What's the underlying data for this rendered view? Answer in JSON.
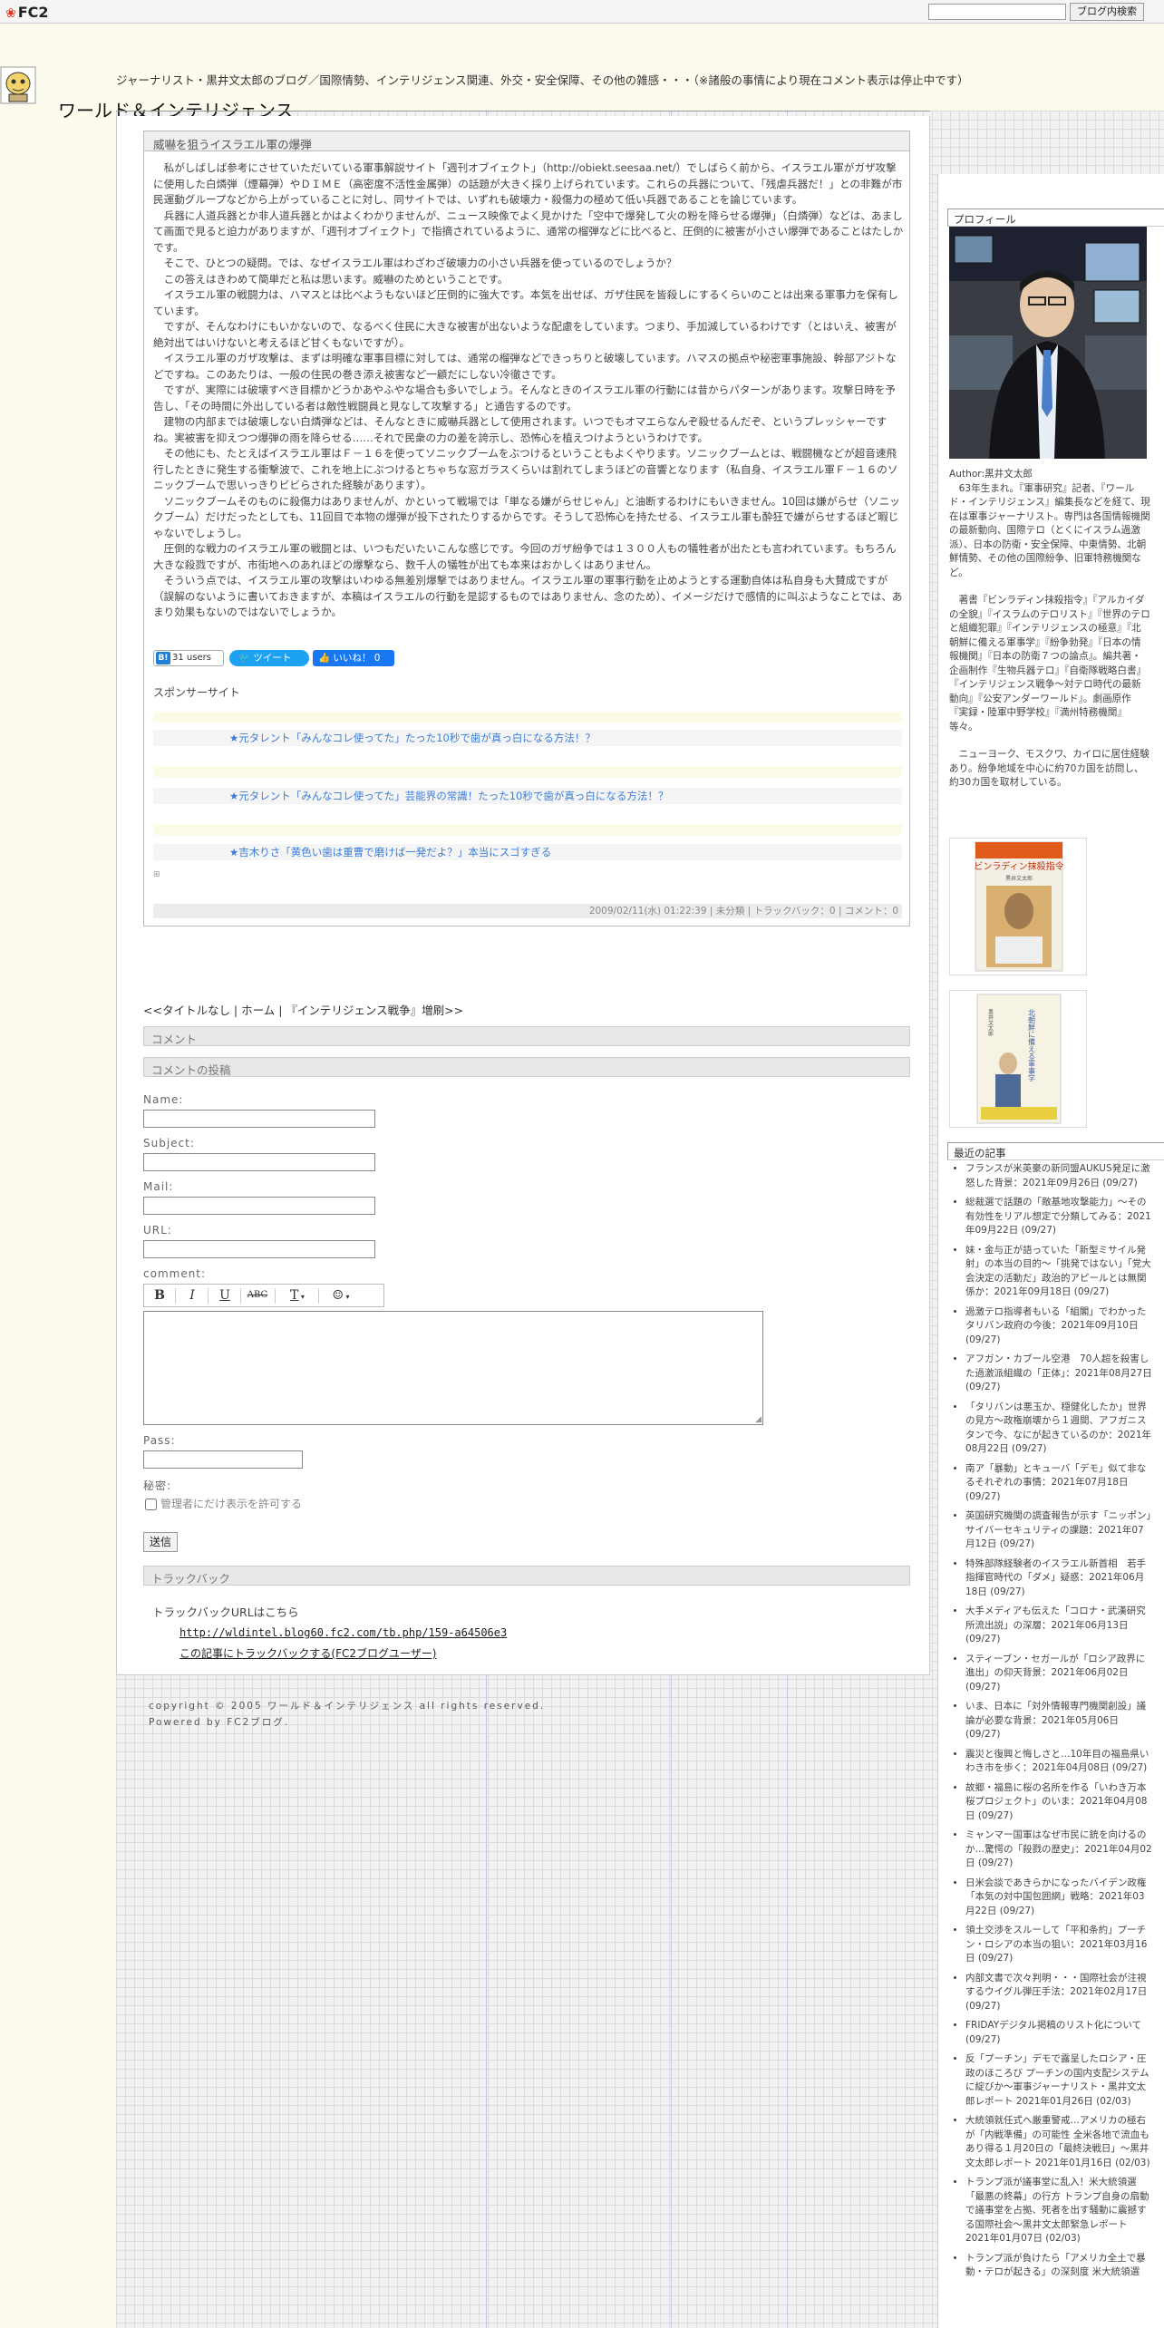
{
  "fc2": {
    "logo": "FC2",
    "search_button": "ブログ内検索"
  },
  "header": {
    "description": "ジャーナリスト・黒井文太郎のブログ／国際情勢、インテリジェンス関連、外交・安全保障、その他の雑感・・・（※諸般の事情により現在コメント表示は停止中です）",
    "title": "ワールド＆インテリジェンス"
  },
  "entry": {
    "title": "威嚇を狙うイスラエル軍の爆弾",
    "paragraphs": [
      "　私がしばしば参考にさせていただいている軍事解説サイト「週刊オブイェクト」（http://obiekt.seesaa.net/）でしばらく前から、イスラエル軍がガザ攻撃に使用した白燐弾（煙幕弾）やＤＩＭＥ（高密度不活性金属弾）の話題が大きく採り上げられています。これらの兵器について、「残虐兵器だ！」との非難が市民運動グループなどから上がっていることに対し、同サイトでは、いずれも破壊力・殺傷力の極めて低い兵器であることを論じています。",
      "　兵器に人道兵器とか非人道兵器とかはよくわかりませんが、ニュース映像でよく見かけた「空中で爆発して火の粉を降らせる爆弾」（白燐弾）などは、あまして画面で見ると迫力がありますが、「週刊オブイェクト」で指摘されているように、通常の榴弾などに比べると、圧倒的に被害が小さい爆弾であることはたしかです。",
      "　そこで、ひとつの疑問。では、なぜイスラエル軍はわざわざ破壊力の小さい兵器を使っているのでしょうか？",
      "　この答えはきわめて簡単だと私は思います。威嚇のためということです。",
      "　イスラエル軍の戦闘力は、ハマスとは比べようもないほど圧倒的に強大です。本気を出せば、ガザ住民を皆殺しにするくらいのことは出来る軍事力を保有しています。",
      "　ですが、そんなわけにもいかないので、なるべく住民に大きな被害が出ないような配慮をしています。つまり、手加減しているわけです（とはいえ、被害が絶対出てはいけないと考えるほど甘くもないですが）。",
      "　イスラエル軍のガザ攻撃は、まずは明確な軍事目標に対しては、通常の榴弾などできっちりと破壊しています。ハマスの拠点や秘密軍事施設、幹部アジトなどですね。このあたりは、一般の住民の巻き添え被害など一顧だにしない冷徹さです。",
      "　ですが、実際には破壊すべき目標かどうかあやふやな場合も多いでしょう。そんなときのイスラエル軍の行動には昔からパターンがあります。攻撃日時を予告し、「その時間に外出している者は敵性戦闘員と見なして攻撃する」と通告するのです。",
      "　建物の内部までは破壊しない白燐弾などは、そんなときに威嚇兵器として使用されます。いつでもオマエらなんぞ殺せるんだぞ、というプレッシャーですね。実被害を抑えつつ爆弾の雨を降らせる……それで民衆の力の差を誇示し、恐怖心を植えつけようというわけです。",
      "　その他にも、たとえばイスラエル軍はＦ－１６を使ってソニックブームをぶつけるということもよくやります。ソニックブームとは、戦闘機などが超音速飛行したときに発生する衝撃波で、これを地上にぶつけるとちゃちな窓ガラスくらいは割れてしまうほどの音響となります（私自身、イスラエル軍Ｆ－１６のソニックブームで思いっきりビビらされた経験があります）。",
      "　ソニックブームそのものに殺傷力はありませんが、かといって戦場では「単なる嫌がらせじゃん」と油断するわけにもいきません。10回は嫌がらせ（ソニックブーム）だけだったとしても、11回目で本物の爆弾が投下されたりするからです。そうして恐怖心を持たせる、イスラエル軍も酔狂で嫌がらせするほど暇じゃないでしょうし。",
      "　圧倒的な戦力のイスラエル軍の戦闘とは、いつもだいたいこんな感じです。今回のガザ紛争では１３００人もの犠牲者が出たとも言われています。もちろん大きな殺戮ですが、市街地へのあれほどの爆撃なら、数千人の犠牲が出ても本来はおかしくはありません。",
      "　そういう点では、イスラエル軍の攻撃はいわゆる無差別爆撃ではありません。イスラエル軍の軍事行動を止めようとする運動自体は私自身も大賛成ですが（誤解のないように書いておきますが、本稿はイスラエルの行動を是認するものではありません、念のため）、イメージだけで感情的に叫ぶようなことでは、あまり効果もないのではないでしょうか。"
    ],
    "share": {
      "hatena_count": "31 users",
      "tweet": "ツイート",
      "like": "いいね！ 0"
    },
    "sponsor_label": "スポンサーサイト",
    "ads": [
      "★元タレント「みんなコレ使ってた」たった10秒で歯が真っ白になる方法！？",
      "★元タレント「みんなコレ使ってた」芸能界の常識！たった10秒で歯が真っ白になる方法！？",
      "★吉木りさ「黄色い歯は重曹で磨けば一発だよ？」本当にスゴすぎる"
    ],
    "footer": "2009/02/11(水) 01:22:39 | 未分類 | トラックバック：0 | コメント：0"
  },
  "nav": {
    "text": "<<タイトルなし | ホーム | 『インテリジェンス戦争』増刷>>"
  },
  "comments": {
    "comment_section": "コメント",
    "post_section": "コメントの投稿",
    "name_label": "Name:",
    "subject_label": "Subject:",
    "mail_label": "Mail:",
    "url_label": "URL:",
    "comment_label": "comment:",
    "toolbar": [
      "B",
      "I",
      "U",
      "ABC",
      "T",
      "☺"
    ],
    "pass_label": "Pass:",
    "secret_label": "秘密:",
    "secret_checkbox": "管理者にだけ表示を許可する",
    "send": "送信"
  },
  "trackback": {
    "section": "トラックバック",
    "label": "トラックバックURLはこちら",
    "url": "http://wldintel.blog60.fc2.com/tb.php/159-a64506e3",
    "link": "この記事にトラックバックする(FC2ブログユーザー)"
  },
  "footer": {
    "copyright": "copyright © 2005 ワールド＆インテリジェンス all rights reserved.",
    "powered": "Powered by FC2ブログ."
  },
  "sidebar": {
    "profile_head": "プロフィール",
    "profile_paragraphs": [
      "Author:黒井文太郎\n　63年生まれ。『軍事研究』記者、『ワールド・インテリジェンス』編集長などを経て、現在は軍事ジャーナリスト。専門は各国情報機関の最新動向、国際テロ（とくにイスラム過激派）、日本の防衛・安全保障、中東情勢、北朝鮮情勢、その他の国際紛争、旧軍特務機関など。",
      "　著書『ビンラディン抹殺指令』『アルカイダの全貌』『イスラムのテロリスト』『世界のテロと組織犯罪』『インテリジェンスの極意』『北朝鮮に備える軍事学』『紛争勃発』『日本の情報機関』『日本の防衛７つの論点』。編共著・企画制作『生物兵器テロ』『自衛隊戦略白書』『インテリジェンス戦争～対テロ時代の最新動向』『公安アンダーワールド』。劇画原作『実録・陸軍中野学校』『満州特務機関』等々。",
      "　ニューヨーク、モスクワ、カイロに居住経験あり。紛争地域を中心に約70カ国を訪問し、約30カ国を取材している。"
    ],
    "books": [
      {
        "title": "ビンラディン抹殺指令",
        "author": "黒井文太郎"
      },
      {
        "title": "北朝鮮に備える軍事学",
        "author": "黒井文太郎"
      }
    ],
    "recent_head": "最近の記事",
    "recent": [
      "フランスが米英豪の新同盟AUKUS発足に激怒した背景：2021年09月26日 (09/27)",
      "総裁選で話題の「敵基地攻撃能力」～その有効性をリアル想定で分類してみる：2021年09月22日 (09/27)",
      "妹・金与正が語っていた「新型ミサイル発射」の本当の目的～「挑発ではない」「党大会決定の活動だ」政治的アピールとは無関係か：2021年09月18日 (09/27)",
      "過激テロ指導者もいる「組閣」でわかったタリバン政府の今後：2021年09月10日 (09/27)",
      "アフガン・カブール空港　70人超を殺害した過激派組織の「正体」：2021年08月27日 (09/27)",
      "「タリバンは悪玉か、穏健化したか」世界の見方～政権崩壊から１週間、アフガニスタンで今、なにが起きているのか：2021年08月22日 (09/27)",
      "南ア「暴動」とキューバ「デモ」似て非なるそれぞれの事情：2021年07月18日 (09/27)",
      "英国研究機関の調査報告が示す「ニッポン」サイバーセキュリティの課題：2021年07月12日 (09/27)",
      "特殊部隊経験者のイスラエル新首相　若手指揮官時代の「ダメ」疑惑：2021年06月18日 (09/27)",
      "大手メディアも伝えた「コロナ・武漢研究所流出説」の深層：2021年06月13日 (09/27)",
      "スティーブン・セガールが「ロシア政界に進出」の仰天背景：2021年06月02日 (09/27)",
      "いま、日本に「対外情報専門機関創設」議論が必要な背景：2021年05月06日 (09/27)",
      "震災と復興と悔しさと…10年目の福島県いわき市を歩く：2021年04月08日 (09/27)",
      "故郷・福島に桜の名所を作る「いわき万本桜プロジェクト」のいま：2021年04月08日 (09/27)",
      "ミャンマー国軍はなぜ市民に銃を向けるのか…驚愕の「殺戮の歴史」：2021年04月02日 (09/27)",
      "日米会談であきらかになったバイデン政権「本気の対中国包囲網」戦略：2021年03月22日 (09/27)",
      "領土交渉をスルーして「平和条約」プーチン・ロシアの本当の狙い：2021年03月16日 (09/27)",
      "内部文書で次々判明・・・国際社会が注視するウイグル弾圧手法：2021年02月17日 (09/27)",
      "FRIDAYデジタル掲稿のリスト化について (09/27)",
      "反「プーチン」デモで露呈したロシア・圧政のほころび プーチンの国内支配システムに綻びか～軍事ジャーナリスト・黒井文太郎レポート 2021年01月26日 (02/03)",
      "大統領就任式へ厳重警戒…アメリカの極右が「内戦準備」の可能性 全米各地で流血もあり得る１月20日の「最終決戦日」～黒井文太郎レポート 2021年01月16日 (02/03)",
      "トランプ派が議事堂に乱入！米大統領選「最悪の終幕」の行方 トランプ自身の扇動で議事堂を占拠、死者を出す騒動に震撼する国際社会～黒井文太郎緊急レポート 2021年01月07日 (02/03)",
      "トランプ派が負けたら「アメリカ全土で暴動・テロが起きる」の深刻度 米大統領選"
    ]
  }
}
